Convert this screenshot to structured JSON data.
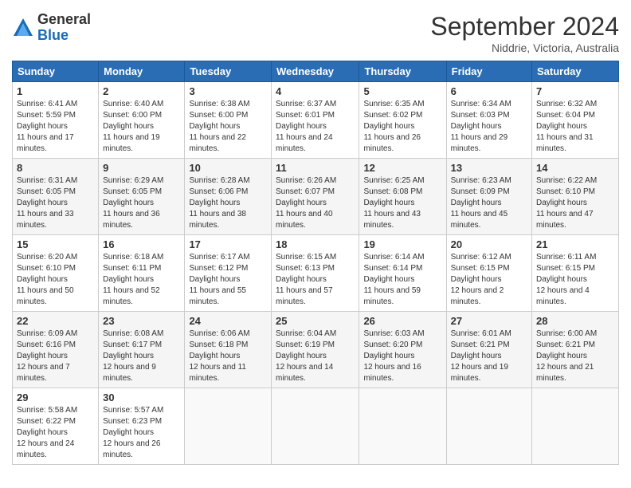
{
  "header": {
    "logo": {
      "general": "General",
      "blue": "Blue"
    },
    "title": "September 2024",
    "location": "Niddrie, Victoria, Australia"
  },
  "calendar": {
    "days_of_week": [
      "Sunday",
      "Monday",
      "Tuesday",
      "Wednesday",
      "Thursday",
      "Friday",
      "Saturday"
    ],
    "weeks": [
      [
        {
          "day": "1",
          "sunrise": "6:41 AM",
          "sunset": "5:59 PM",
          "daylight": "11 hours and 17 minutes."
        },
        {
          "day": "2",
          "sunrise": "6:40 AM",
          "sunset": "6:00 PM",
          "daylight": "11 hours and 19 minutes."
        },
        {
          "day": "3",
          "sunrise": "6:38 AM",
          "sunset": "6:00 PM",
          "daylight": "11 hours and 22 minutes."
        },
        {
          "day": "4",
          "sunrise": "6:37 AM",
          "sunset": "6:01 PM",
          "daylight": "11 hours and 24 minutes."
        },
        {
          "day": "5",
          "sunrise": "6:35 AM",
          "sunset": "6:02 PM",
          "daylight": "11 hours and 26 minutes."
        },
        {
          "day": "6",
          "sunrise": "6:34 AM",
          "sunset": "6:03 PM",
          "daylight": "11 hours and 29 minutes."
        },
        {
          "day": "7",
          "sunrise": "6:32 AM",
          "sunset": "6:04 PM",
          "daylight": "11 hours and 31 minutes."
        }
      ],
      [
        {
          "day": "8",
          "sunrise": "6:31 AM",
          "sunset": "6:05 PM",
          "daylight": "11 hours and 33 minutes."
        },
        {
          "day": "9",
          "sunrise": "6:29 AM",
          "sunset": "6:05 PM",
          "daylight": "11 hours and 36 minutes."
        },
        {
          "day": "10",
          "sunrise": "6:28 AM",
          "sunset": "6:06 PM",
          "daylight": "11 hours and 38 minutes."
        },
        {
          "day": "11",
          "sunrise": "6:26 AM",
          "sunset": "6:07 PM",
          "daylight": "11 hours and 40 minutes."
        },
        {
          "day": "12",
          "sunrise": "6:25 AM",
          "sunset": "6:08 PM",
          "daylight": "11 hours and 43 minutes."
        },
        {
          "day": "13",
          "sunrise": "6:23 AM",
          "sunset": "6:09 PM",
          "daylight": "11 hours and 45 minutes."
        },
        {
          "day": "14",
          "sunrise": "6:22 AM",
          "sunset": "6:10 PM",
          "daylight": "11 hours and 47 minutes."
        }
      ],
      [
        {
          "day": "15",
          "sunrise": "6:20 AM",
          "sunset": "6:10 PM",
          "daylight": "11 hours and 50 minutes."
        },
        {
          "day": "16",
          "sunrise": "6:18 AM",
          "sunset": "6:11 PM",
          "daylight": "11 hours and 52 minutes."
        },
        {
          "day": "17",
          "sunrise": "6:17 AM",
          "sunset": "6:12 PM",
          "daylight": "11 hours and 55 minutes."
        },
        {
          "day": "18",
          "sunrise": "6:15 AM",
          "sunset": "6:13 PM",
          "daylight": "11 hours and 57 minutes."
        },
        {
          "day": "19",
          "sunrise": "6:14 AM",
          "sunset": "6:14 PM",
          "daylight": "11 hours and 59 minutes."
        },
        {
          "day": "20",
          "sunrise": "6:12 AM",
          "sunset": "6:15 PM",
          "daylight": "12 hours and 2 minutes."
        },
        {
          "day": "21",
          "sunrise": "6:11 AM",
          "sunset": "6:15 PM",
          "daylight": "12 hours and 4 minutes."
        }
      ],
      [
        {
          "day": "22",
          "sunrise": "6:09 AM",
          "sunset": "6:16 PM",
          "daylight": "12 hours and 7 minutes."
        },
        {
          "day": "23",
          "sunrise": "6:08 AM",
          "sunset": "6:17 PM",
          "daylight": "12 hours and 9 minutes."
        },
        {
          "day": "24",
          "sunrise": "6:06 AM",
          "sunset": "6:18 PM",
          "daylight": "12 hours and 11 minutes."
        },
        {
          "day": "25",
          "sunrise": "6:04 AM",
          "sunset": "6:19 PM",
          "daylight": "12 hours and 14 minutes."
        },
        {
          "day": "26",
          "sunrise": "6:03 AM",
          "sunset": "6:20 PM",
          "daylight": "12 hours and 16 minutes."
        },
        {
          "day": "27",
          "sunrise": "6:01 AM",
          "sunset": "6:21 PM",
          "daylight": "12 hours and 19 minutes."
        },
        {
          "day": "28",
          "sunrise": "6:00 AM",
          "sunset": "6:21 PM",
          "daylight": "12 hours and 21 minutes."
        }
      ],
      [
        {
          "day": "29",
          "sunrise": "5:58 AM",
          "sunset": "6:22 PM",
          "daylight": "12 hours and 24 minutes."
        },
        {
          "day": "30",
          "sunrise": "5:57 AM",
          "sunset": "6:23 PM",
          "daylight": "12 hours and 26 minutes."
        },
        null,
        null,
        null,
        null,
        null
      ]
    ]
  }
}
